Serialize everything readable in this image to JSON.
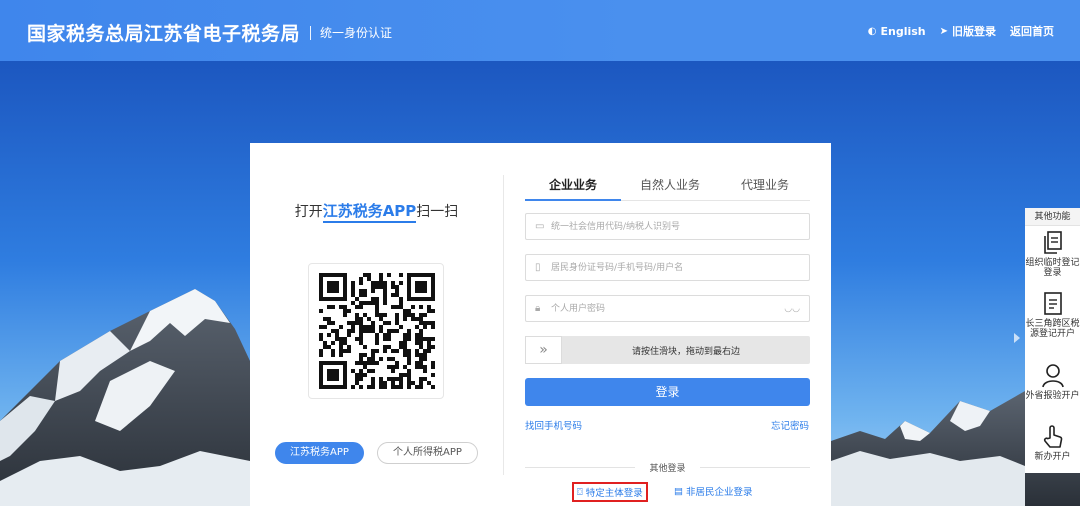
{
  "header": {
    "title": "国家税务总局江苏省电子税务局",
    "subtitle": "统一身份认证",
    "nav": [
      {
        "label": "English",
        "icon": "globe-icon"
      },
      {
        "label": "旧版登录",
        "icon": "send-icon"
      },
      {
        "label": "返回首页",
        "icon": ""
      }
    ]
  },
  "qr_panel": {
    "title_prefix": "打开",
    "title_highlight": "江苏税务APP",
    "title_suffix": "扫一扫",
    "buttons": [
      "江苏税务APP",
      "个人所得税APP"
    ]
  },
  "tabs": [
    {
      "label": "企业业务",
      "active": true
    },
    {
      "label": "自然人业务",
      "active": false
    },
    {
      "label": "代理业务",
      "active": false
    }
  ],
  "form": {
    "credit_code_placeholder": "统一社会信用代码/纳税人识别号",
    "id_placeholder": "居民身份证号码/手机号码/用户名",
    "password_placeholder": "个人用户密码",
    "slider_text": "请按住滑块，拖动到最右边",
    "login_label": "登录",
    "find_phone_link": "找回手机号码",
    "forgot_password_link": "忘记密码"
  },
  "other_login": {
    "title": "其他登录",
    "options": [
      {
        "label": "特定主体登录",
        "icon": "camera-icon",
        "highlighted": true
      },
      {
        "label": "非居民企业登录",
        "icon": "building-id-icon",
        "highlighted": false
      }
    ]
  },
  "side_panel": {
    "title": "其他功能",
    "items": [
      {
        "label": "组织临时登记登录",
        "icon": "copy-document-icon"
      },
      {
        "label": "长三角跨区税源登记开户",
        "icon": "document-icon"
      },
      {
        "label": "外省报验开户",
        "icon": "user-icon"
      },
      {
        "label": "新办开户",
        "icon": "hand-pointer-icon"
      }
    ]
  },
  "colors": {
    "primary": "#3f86ec",
    "link": "#2b7ce9",
    "highlight_border": "#e02020"
  }
}
